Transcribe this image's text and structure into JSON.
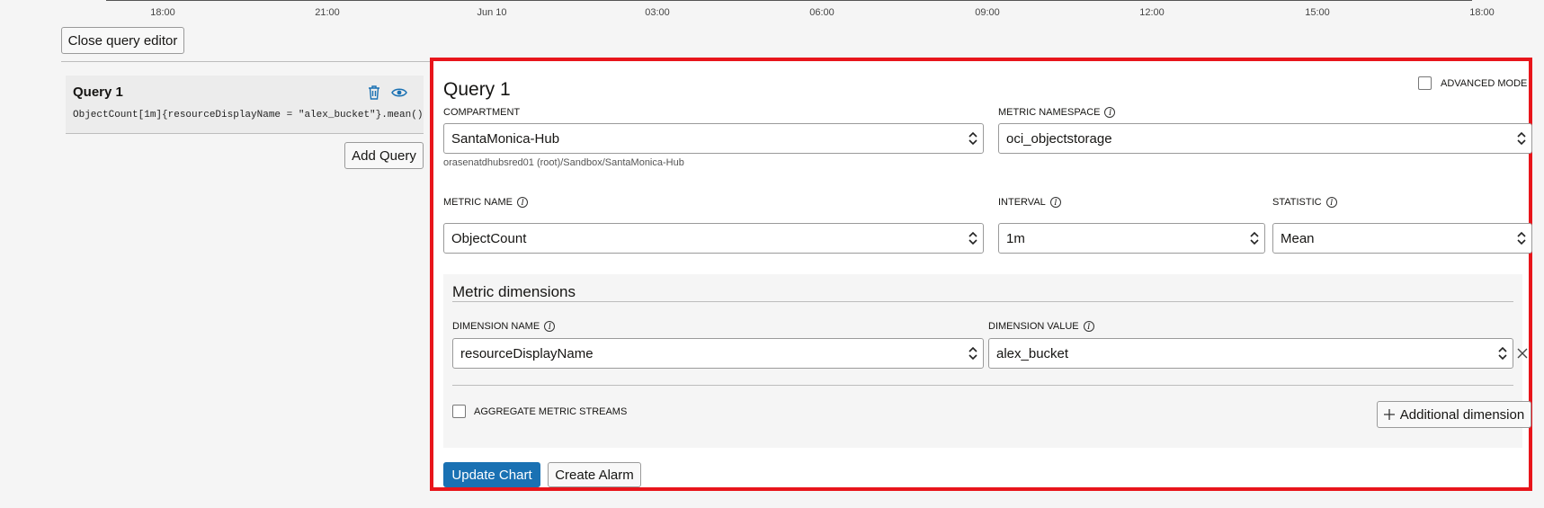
{
  "timeline": {
    "ticks": [
      "18:00",
      "21:00",
      "Jun 10",
      "03:00",
      "06:00",
      "09:00",
      "12:00",
      "15:00",
      "18:00"
    ]
  },
  "toolbar": {
    "close_editor_label": "Close query editor",
    "add_query_label": "Add Query"
  },
  "query_list": [
    {
      "title": "Query 1",
      "expression": "ObjectCount[1m]{resourceDisplayName = \"alex_bucket\"}.mean()"
    }
  ],
  "editor": {
    "title": "Query 1",
    "advanced_mode_label": "ADVANCED MODE",
    "advanced_mode_checked": false,
    "compartment": {
      "label": "COMPARTMENT",
      "value": "SantaMonica-Hub",
      "path": "orasenatdhubsred01 (root)/Sandbox/SantaMonica-Hub"
    },
    "metric_namespace": {
      "label": "METRIC NAMESPACE",
      "value": "oci_objectstorage"
    },
    "metric_name": {
      "label": "METRIC NAME",
      "value": "ObjectCount"
    },
    "interval": {
      "label": "INTERVAL",
      "value": "1m"
    },
    "statistic": {
      "label": "STATISTIC",
      "value": "Mean"
    },
    "dimensions": {
      "title": "Metric dimensions",
      "name_label": "DIMENSION NAME",
      "value_label": "DIMENSION VALUE",
      "name_value": "resourceDisplayName",
      "value_value": "alex_bucket",
      "aggregate_label": "AGGREGATE METRIC STREAMS",
      "aggregate_checked": false,
      "additional_label": "Additional dimension"
    },
    "update_chart_label": "Update Chart",
    "create_alarm_label": "Create Alarm"
  },
  "colors": {
    "primary": "#1a71b3",
    "highlight": "#e8151b",
    "icon_blue": "#1a71b3"
  }
}
